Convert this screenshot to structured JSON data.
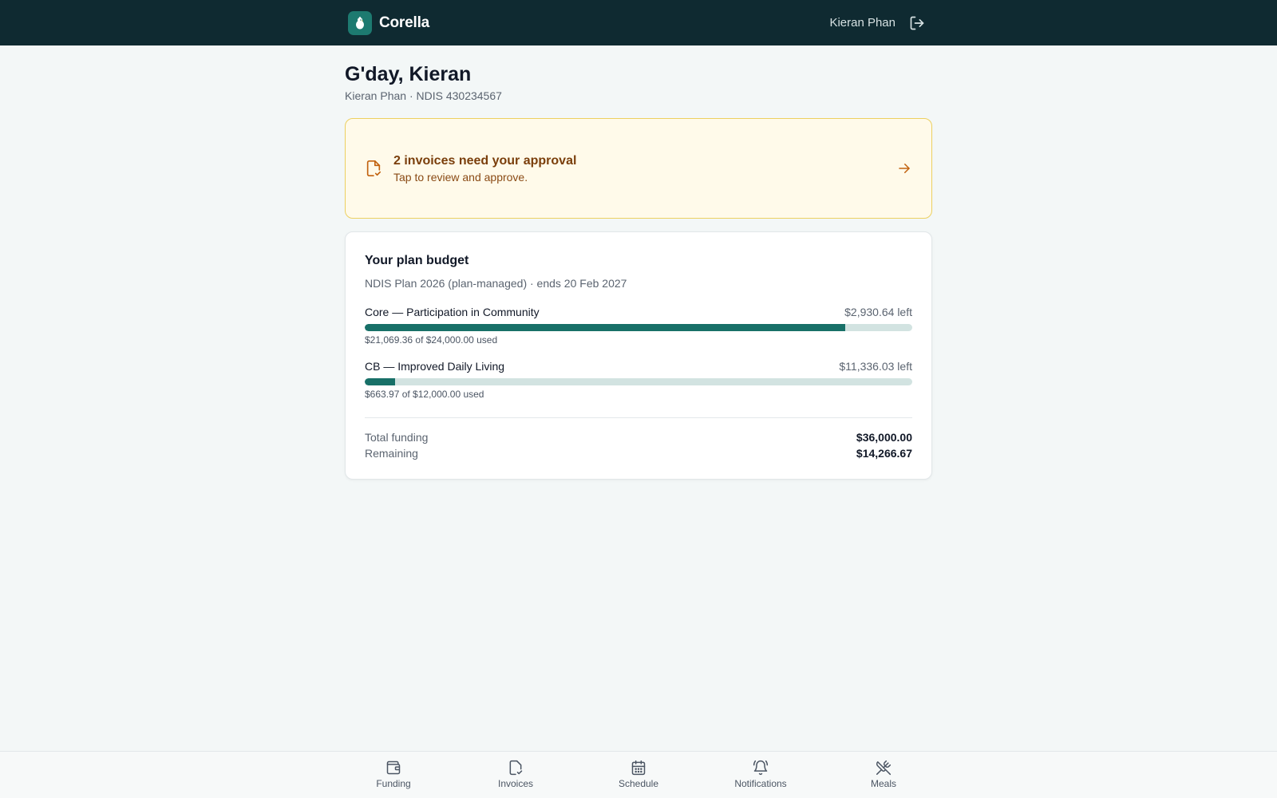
{
  "app": {
    "name": "Corella",
    "user_name": "Kieran Phan"
  },
  "header": {
    "greeting": "G'day, Kieran",
    "subline": "Kieran Phan · NDIS 430234567"
  },
  "alert": {
    "title": "2 invoices need your approval",
    "subtitle": "Tap to review and approve."
  },
  "budget": {
    "title": "Your plan budget",
    "plan": "NDIS Plan 2026 (plan-managed) · ends 20 Feb 2027",
    "categories": [
      {
        "label": "Core — Participation in Community",
        "left": "$2,930.64 left",
        "used": "$21,069.36 of $24,000.00 used",
        "used_fraction": 0.8779
      },
      {
        "label": "CB — Improved Daily Living",
        "left": "$11,336.03 left",
        "used": "$663.97 of $12,000.00 used",
        "used_fraction": 0.0553
      }
    ],
    "total_funding_label": "Total funding",
    "total_funding": "$36,000.00",
    "remaining_label": "Remaining",
    "remaining": "$14,266.67"
  },
  "nav": {
    "items": [
      {
        "label": "Funding",
        "icon": "wallet-icon"
      },
      {
        "label": "Invoices",
        "icon": "file-check-icon"
      },
      {
        "label": "Schedule",
        "icon": "calendar-icon"
      },
      {
        "label": "Notifications",
        "icon": "bell-icon"
      },
      {
        "label": "Meals",
        "icon": "utensils-icon"
      }
    ]
  },
  "colors": {
    "topbar": "#0f2a31",
    "accent": "#187068",
    "alert_bg": "#fffaea",
    "alert_border": "#ecd060",
    "alert_text": "#7a3e0b"
  }
}
